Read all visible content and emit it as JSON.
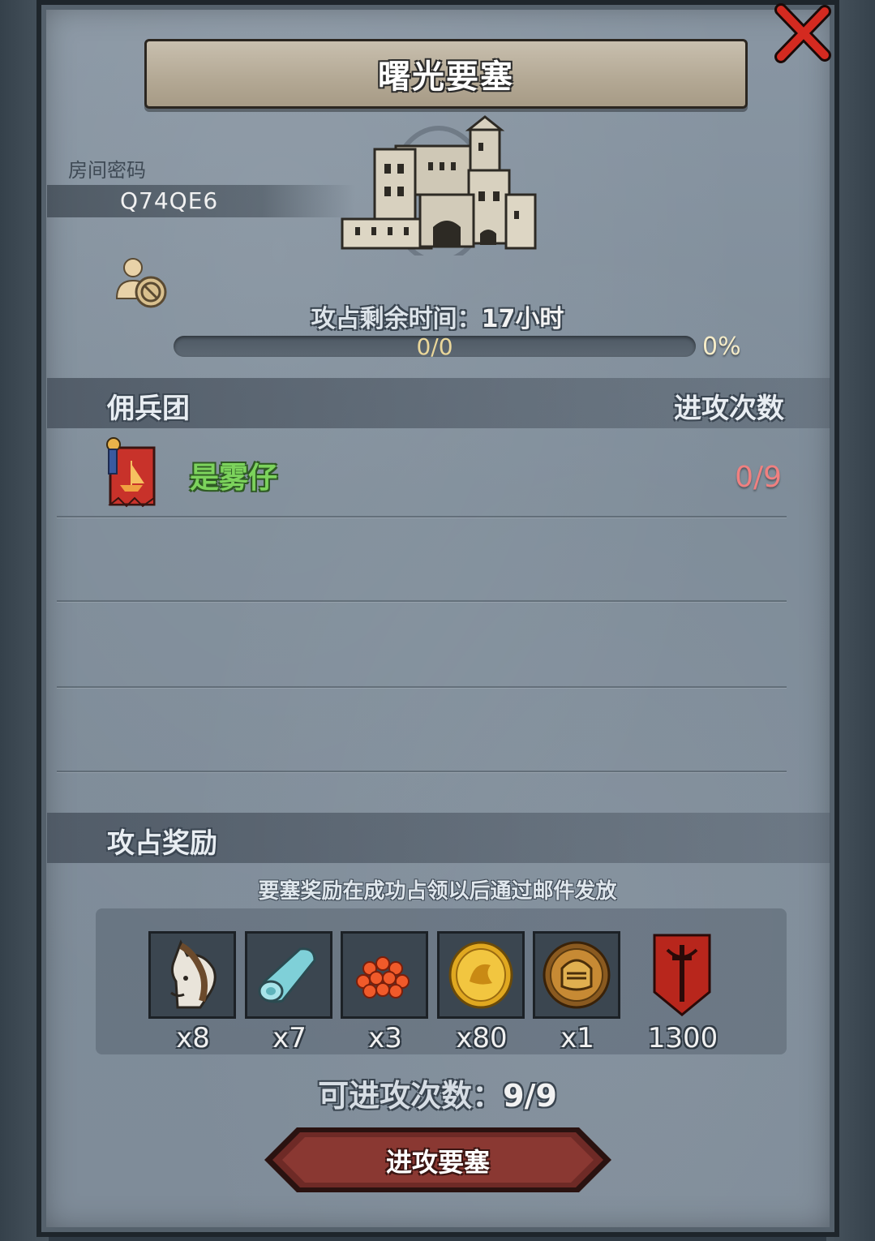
{
  "dialog": {
    "title": "曙光要塞",
    "room_label": "房间密码",
    "room_code": "Q74QE6"
  },
  "siege": {
    "time_label": "攻占剩余时间：",
    "time_value": "17小时",
    "progress_text": "0/0",
    "progress_percent": "0%",
    "progress_fraction": 0
  },
  "mercenary": {
    "header": "佣兵团",
    "attacks_header": "进攻次数",
    "rows": [
      {
        "name": "是雾仔",
        "attacks": "0/9"
      }
    ]
  },
  "rewards": {
    "header": "攻占奖励",
    "note": "要塞奖励在成功占领以后通过邮件发放",
    "items": [
      {
        "icon": "horse-icon",
        "qty": "x8"
      },
      {
        "icon": "cloth-roll-icon",
        "qty": "x7"
      },
      {
        "icon": "red-berries-icon",
        "qty": "x3"
      },
      {
        "icon": "gold-coin-icon",
        "qty": "x80"
      },
      {
        "icon": "knight-helmet-coin-icon",
        "qty": "x1"
      },
      {
        "icon": "red-shield-sword-icon",
        "qty": "1300"
      }
    ]
  },
  "attempts": {
    "label": "可进攻次数：",
    "value": "9/9"
  },
  "actions": {
    "attack_label": "进攻要塞"
  },
  "colors": {
    "guild_name": "#7cd35c",
    "attacks_count": "#f08080",
    "close_x": "#d42a20",
    "attack_button": "#6e2a26"
  }
}
